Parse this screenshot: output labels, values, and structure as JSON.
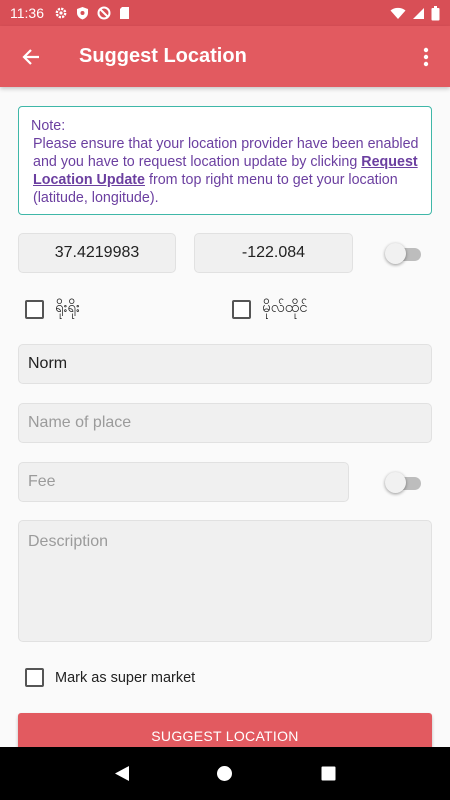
{
  "status_bar": {
    "time": "11:36",
    "icons": [
      "settings-icon",
      "shield-icon",
      "no-entry-icon",
      "sd-card-icon",
      "wifi-icon",
      "signal-icon",
      "battery-icon"
    ]
  },
  "app_bar": {
    "title": "Suggest Location",
    "back_icon": "arrow-back-icon",
    "menu_icon": "more-vert-icon"
  },
  "note": {
    "heading": "Note:",
    "text_before": "Please ensure that your location provider have been enabled and you have to request location update by clicking ",
    "link": "Request Location Update",
    "text_after": " from top right menu to get your location (latitude, longitude)."
  },
  "location": {
    "latitude": "37.4219983",
    "longitude": "-122.084",
    "toggle_on": false
  },
  "checkboxes": {
    "option1": {
      "label": "ရိုးရိုး",
      "checked": false
    },
    "option2": {
      "label": "မိုလ်ထိုင်",
      "checked": false
    }
  },
  "form": {
    "type_value": "Norm",
    "name_placeholder": "Name of place",
    "fee_placeholder": "Fee",
    "fee_toggle_on": false,
    "description_placeholder": "Description"
  },
  "super_market": {
    "label": "Mark as super market",
    "checked": false
  },
  "submit_label": "Suggest Location",
  "colors": {
    "status_bar": "#d84f56",
    "app_bar": "#e25a60",
    "note_border": "#3fb7a8",
    "note_text": "#6b3fa0"
  }
}
